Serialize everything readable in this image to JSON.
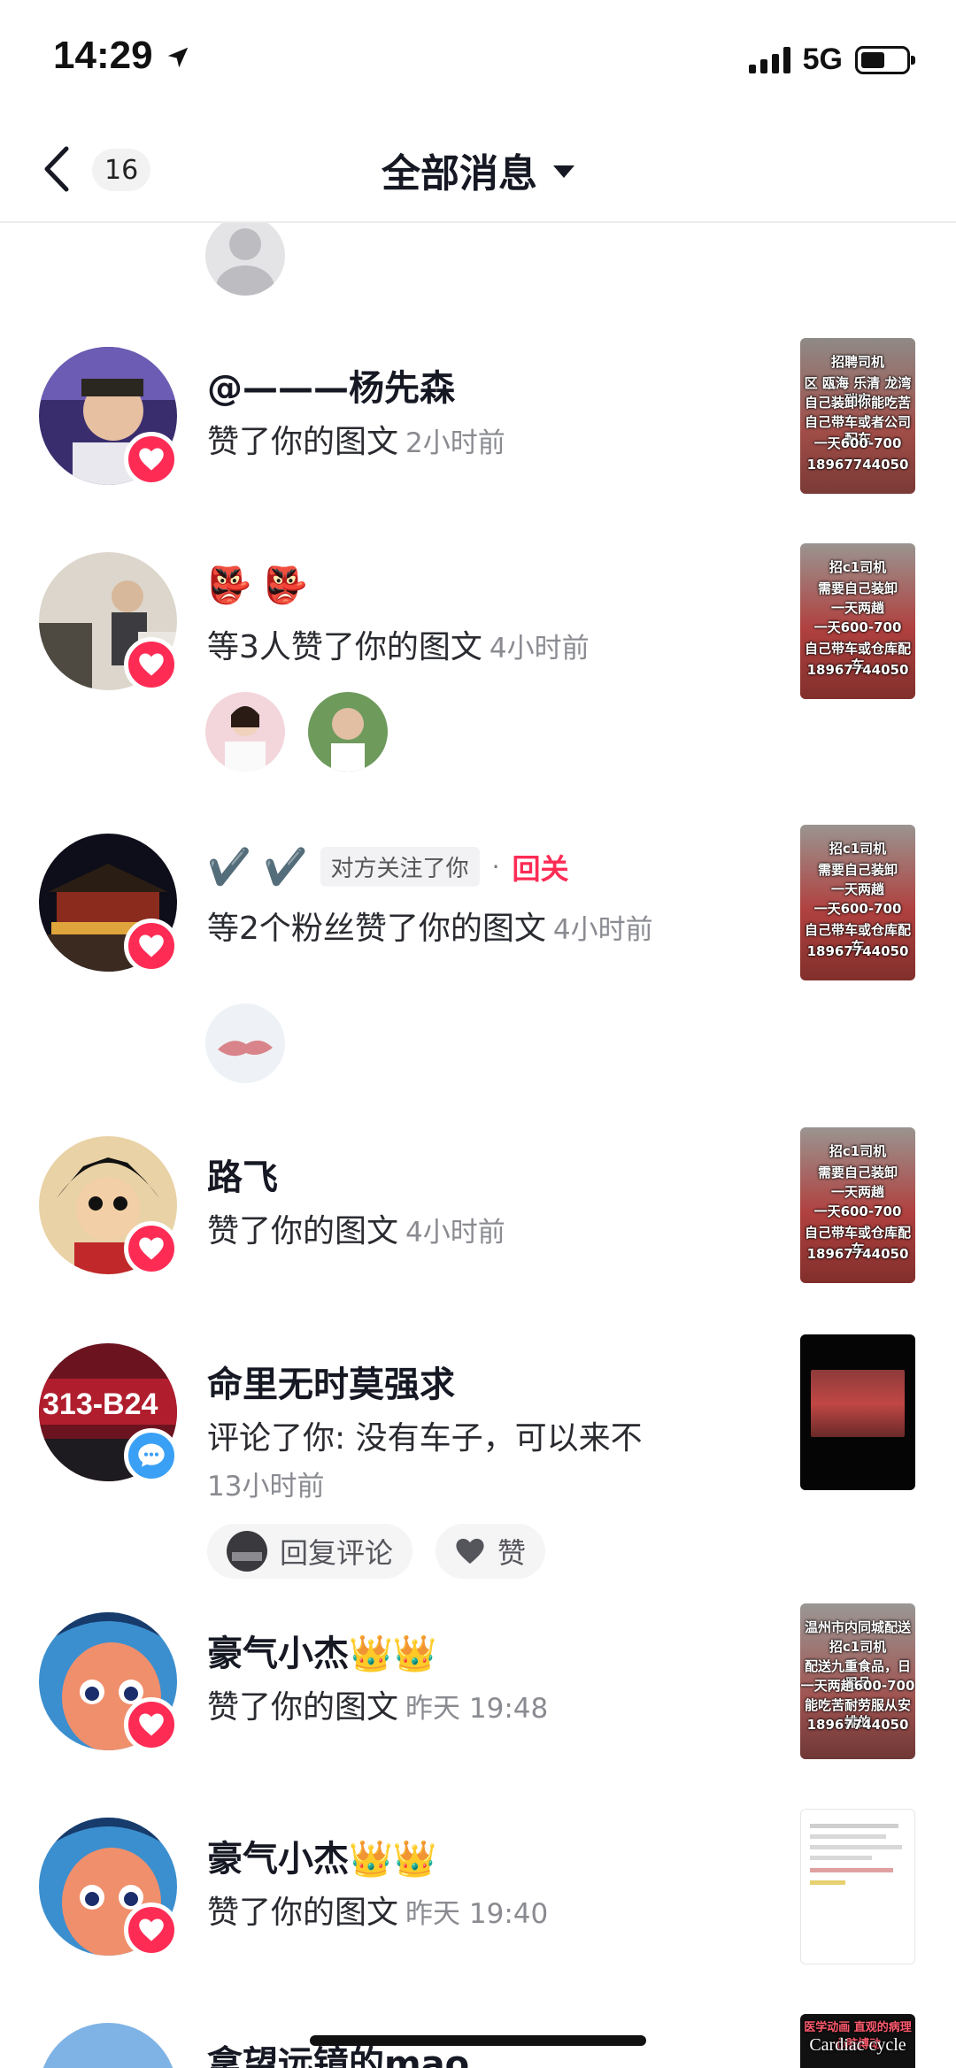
{
  "status_bar": {
    "time": "14:29",
    "network": "5G"
  },
  "nav": {
    "badge_count": "16",
    "title": "全部消息"
  },
  "notifications": [
    {
      "name": "@———杨先森",
      "action": "赞了你的图文",
      "time": "2小时前",
      "type": "like",
      "thumb_lines": [
        "招聘司机",
        "区 瓯海 乐清 龙湾 瑞安",
        "自己装卸你能吃苦",
        "自己带车或者公司配车",
        "一天600-700",
        "18967744050"
      ]
    },
    {
      "name_emoji": "👺 👺",
      "action": "等3人赞了你的图文",
      "time": "4小时前",
      "type": "like",
      "thumb_lines": [
        "招c1司机",
        "需要自己装卸",
        "一天两趟",
        "一天600-700",
        "自己带车或仓库配车",
        "18967744050"
      ]
    },
    {
      "name": "✔️ ✔️",
      "tag": "对方关注了你",
      "separator": "·",
      "follow_back": "回关",
      "action": "等2个粉丝赞了你的图文",
      "time": "4小时前",
      "type": "like",
      "thumb_lines": [
        "招c1司机",
        "需要自己装卸",
        "一天两趟",
        "一天600-700",
        "自己带车或仓库配车",
        "18967744050"
      ]
    },
    {
      "name": "路飞",
      "action": "赞了你的图文",
      "time": "4小时前",
      "type": "like",
      "thumb_lines": [
        "招c1司机",
        "需要自己装卸",
        "一天两趟",
        "一天600-700",
        "自己带车或仓库配车",
        "18967744050"
      ]
    },
    {
      "name": "命里无时莫强求",
      "action": "评论了你: 没有车子，可以来不",
      "time": "13小时前",
      "type": "comment",
      "reply_label": "回复评论",
      "like_label": "赞"
    },
    {
      "name": "豪气小杰👑👑",
      "action": "赞了你的图文",
      "time": "昨天 19:48",
      "type": "like",
      "thumb_lines": [
        "温州市内同城配送",
        "招c1司机",
        "配送九重食品，日用品",
        "一天两趟600-700",
        "能吃苦耐劳服从安排的",
        "18967744050"
      ]
    },
    {
      "name": "豪气小杰👑👑",
      "action": "赞了你的图文",
      "time": "昨天 19:40",
      "type": "like"
    },
    {
      "name": "拿望远镜的mao",
      "type": "like",
      "thumb_lines": [
        "医学动画 直观的病理心脏博动",
        "Cardiac cycle"
      ]
    }
  ]
}
